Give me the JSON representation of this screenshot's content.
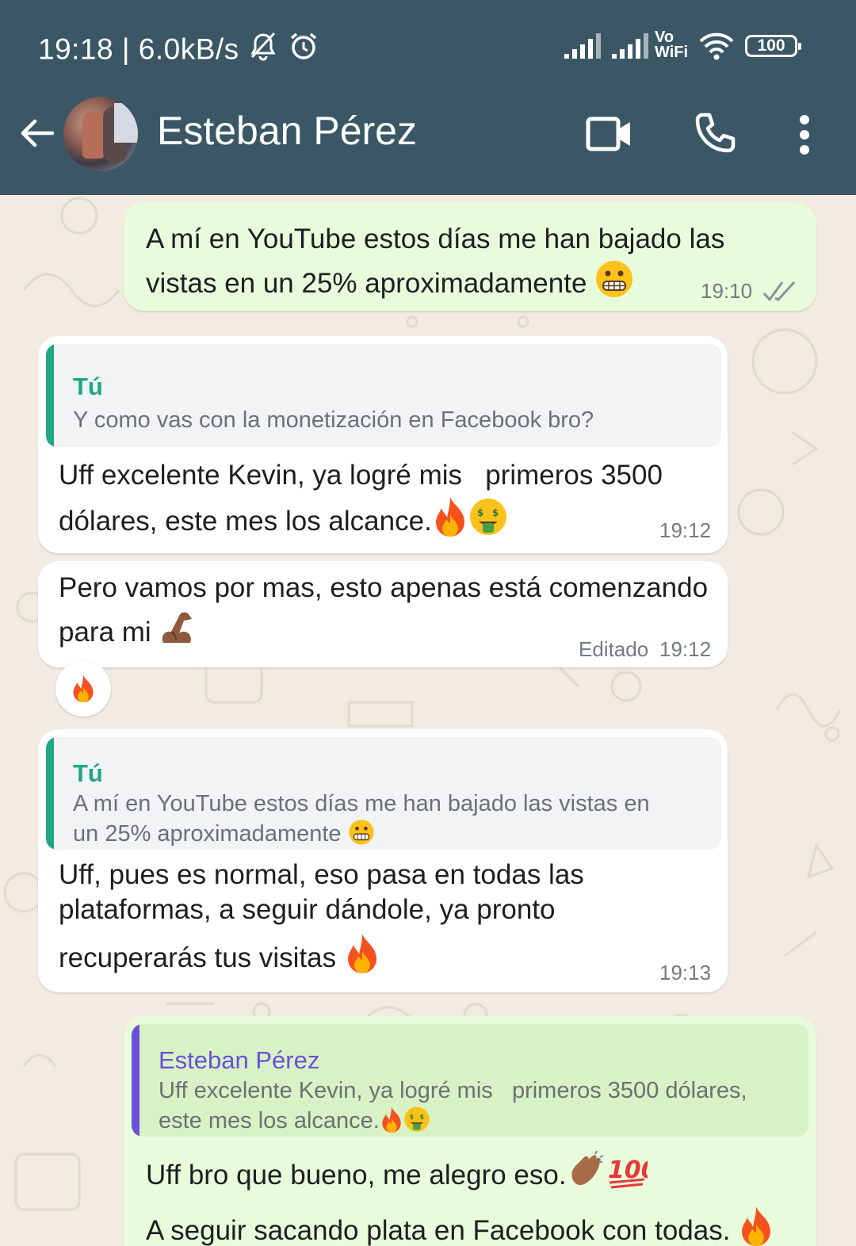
{
  "status_bar": {
    "time_speed": "19:18 | 6.0kB/s",
    "wifi_label_top": "Vo",
    "wifi_label_bottom": "WiFi",
    "battery": "100"
  },
  "header": {
    "contact_name": "Esteban Pérez"
  },
  "messages": [
    {
      "text": "A mí en YouTube estos días me han bajado las vistas en un 25% aproximadamente",
      "line1": "A mí en YouTube estos días me han bajado las",
      "line2": "vistas en un 25% aproximadamente",
      "time": "19:10"
    },
    {
      "quote_name": "Tú",
      "quote_text": "Y como vas con la monetización en Facebook bro?",
      "line1": "Uff excelente Kevin, ya logré mis   primeros 3500",
      "line2": "dólares, este mes los alcance.",
      "time": "19:12"
    },
    {
      "line1": "Pero vamos por mas, esto apenas está comenzando",
      "line2": "para mi",
      "edited_label": "Editado",
      "time": "19:12",
      "reaction": "fire"
    },
    {
      "quote_name": "Tú",
      "quote_line1": "A mí en YouTube estos días me han bajado las vistas en",
      "quote_line2": "un 25% aproximadamente",
      "line1": "Uff, pues es normal, eso pasa en todas las",
      "line2": "plataformas, a seguir dándole, ya pronto",
      "line3": "recuperarás tus visitas",
      "time": "19:13"
    },
    {
      "quote_name": "Esteban Pérez",
      "quote_line1": "Uff excelente Kevin, ya logré mis   primeros 3500 dólares,",
      "quote_line2": "este mes los alcance.",
      "line1": "Uff bro que bueno, me alegro eso.",
      "line2": "A seguir sacando plata en Facebook con todas."
    }
  ],
  "colors": {
    "header_bg": "#3b5766",
    "outgoing_bubble": "#e8fbdb",
    "incoming_bubble": "#ffffff",
    "quote_you": "#1fa784",
    "quote_contact": "#6b4fd8",
    "read_ticks": "#8a9196"
  },
  "icons": [
    "back-arrow-icon",
    "video-call-icon",
    "phone-icon",
    "more-vertical-icon",
    "mute-bell-icon",
    "alarm-icon",
    "signal-icon",
    "wifi-icon",
    "battery-icon",
    "double-check-icon"
  ]
}
